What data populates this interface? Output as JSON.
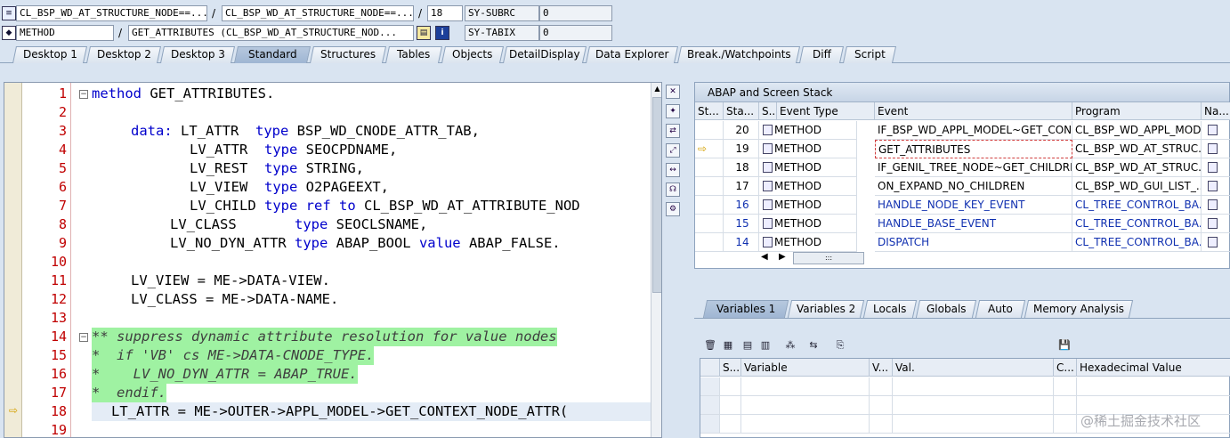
{
  "header": {
    "row1": {
      "field1": "CL_BSP_WD_AT_STRUCTURE_NODE==...",
      "sep1": "/",
      "field2": "CL_BSP_WD_AT_STRUCTURE_NODE==...",
      "sep2": "/",
      "line": "18",
      "sysvar": "SY-SUBRC",
      "sysval": "0"
    },
    "row2": {
      "field1": "METHOD",
      "sep1": "/",
      "field2": "GET_ATTRIBUTES (CL_BSP_WD_AT_STRUCTURE_NOD...",
      "sysvar": "SY-TABIX",
      "sysval": "0"
    }
  },
  "tabs": [
    "Desktop 1",
    "Desktop 2",
    "Desktop 3",
    "Standard",
    "Structures",
    "Tables",
    "Objects",
    "DetailDisplay",
    "Data Explorer",
    "Break./Watchpoints",
    "Diff",
    "Script"
  ],
  "active_tab": "Standard",
  "editor": {
    "lines": [
      {
        "n": "1"
      },
      {
        "n": "2"
      },
      {
        "n": "3"
      },
      {
        "n": "4"
      },
      {
        "n": "5"
      },
      {
        "n": "6"
      },
      {
        "n": "7"
      },
      {
        "n": "8"
      },
      {
        "n": "9"
      },
      {
        "n": "10"
      },
      {
        "n": "11"
      },
      {
        "n": "12"
      },
      {
        "n": "13"
      },
      {
        "n": "14"
      },
      {
        "n": "15"
      },
      {
        "n": "16"
      },
      {
        "n": "17"
      },
      {
        "n": "18"
      },
      {
        "n": "19"
      }
    ],
    "code": {
      "l1_kw": "method",
      "l1_rest": " GET_ATTRIBUTES.",
      "l3_kw": "data:",
      "l3_a": " LT_ATTR  ",
      "l3_kw2": "type",
      "l3_b": " BSP_WD_CNODE_ATTR_TAB,",
      "l4_a": "LV_ATTR  ",
      "l4_kw": "type",
      "l4_b": " SEOCPDNAME,",
      "l5_a": "LV_REST  ",
      "l5_kw": "type",
      "l5_b": " STRING,",
      "l6_a": "LV_VIEW  ",
      "l6_kw": "type",
      "l6_b": " O2PAGEEXT,",
      "l7_a": "LV_CHILD ",
      "l7_kw": "type",
      "l7_kw2": "ref to",
      "l7_b": " CL_BSP_WD_AT_ATTRIBUTE_NOD",
      "l8_a": "LV_CLASS       ",
      "l8_kw": "type",
      "l8_b": " SEOCLSNAME,",
      "l9_a": "LV_NO_DYN_ATTR ",
      "l9_kw": "type",
      "l9_b": " ABAP_BOOL ",
      "l9_kw2": "value",
      "l9_c": " ABAP_FALSE.",
      "l11": "LV_VIEW = ME->DATA-VIEW.",
      "l12": "LV_CLASS = ME->DATA-NAME.",
      "l14": "** suppress dynamic attribute resolution for value nodes",
      "l15": "*  if 'VB' cs ME->DATA-CNODE_TYPE.",
      "l16": "*    LV_NO_DYN_ATTR = ABAP_TRUE.",
      "l17": "*  endif.",
      "l18": "LT_ATTR = ME->OUTER->APPL_MODEL->GET_CONTEXT_NODE_ATTR("
    }
  },
  "stack": {
    "title": "ABAP and Screen Stack",
    "columns": [
      "St...",
      "Sta...",
      "S...",
      "Event Type",
      "Event",
      "Program",
      "Na..."
    ],
    "rows": [
      {
        "level": "20",
        "type": "METHOD",
        "event": "IF_BSP_WD_APPL_MODEL~GET_CON...",
        "program": "CL_BSP_WD_APPL_MOD..."
      },
      {
        "level": "19",
        "type": "METHOD",
        "event": "GET_ATTRIBUTES",
        "program": "CL_BSP_WD_AT_STRUC..."
      },
      {
        "level": "18",
        "type": "METHOD",
        "event": "IF_GENIL_TREE_NODE~GET_CHILDREN",
        "program": "CL_BSP_WD_AT_STRUC..."
      },
      {
        "level": "17",
        "type": "METHOD",
        "event": "ON_EXPAND_NO_CHILDREN",
        "program": "CL_BSP_WD_GUI_LIST_..."
      },
      {
        "level": "16",
        "type": "METHOD",
        "event": "HANDLE_NODE_KEY_EVENT",
        "program": "CL_TREE_CONTROL_BA..."
      },
      {
        "level": "15",
        "type": "METHOD",
        "event": "HANDLE_BASE_EVENT",
        "program": "CL_TREE_CONTROL_BA..."
      },
      {
        "level": "14",
        "type": "METHOD",
        "event": "DISPATCH",
        "program": "CL_TREE_CONTROL_BA..."
      }
    ],
    "current_row": 1,
    "hscroll": ":::"
  },
  "var_tabs": [
    "Variables 1",
    "Variables 2",
    "Locals",
    "Globals",
    "Auto",
    "Memory Analysis"
  ],
  "var_columns": [
    "S...",
    "Variable",
    "V...",
    "Val.",
    "C...",
    "Hexadecimal Value"
  ],
  "watermark": "@稀土掘金技术社区",
  "icons": [
    "list-icon",
    "object-icon",
    "stack-icon",
    "info-icon",
    "trash-icon",
    "arrow-icon",
    "save-icon"
  ]
}
